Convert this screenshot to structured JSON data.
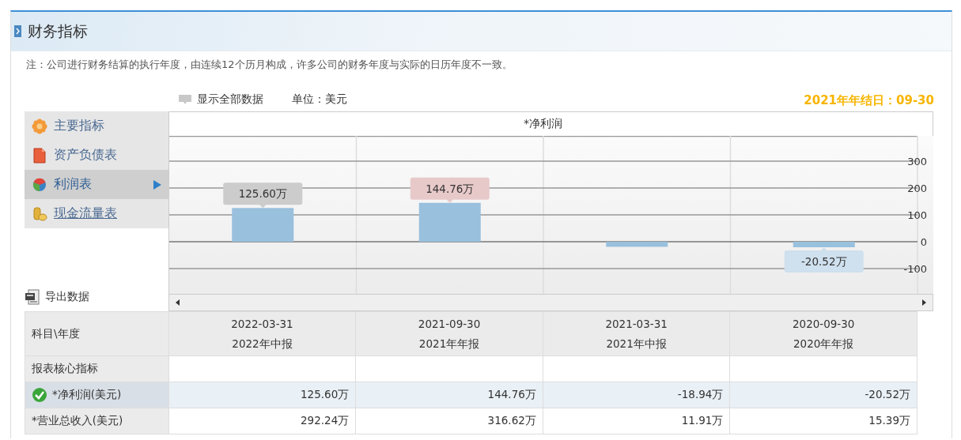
{
  "panel": {
    "title": "财务指标"
  },
  "note": "注：公司进行财务结算的执行年度，由连续12个历月构成，许多公司的财务年度与实际的日历年度不一致。",
  "toolbar": {
    "show_all": "显示全部数据",
    "unit": "单位：美元",
    "year_end": "2021年年结日：09-30"
  },
  "sidebar": {
    "items": [
      {
        "label": "主要指标",
        "kind": "flower",
        "selected": false,
        "underlined": false
      },
      {
        "label": "资产负债表",
        "kind": "document",
        "selected": false,
        "underlined": false
      },
      {
        "label": "利润表",
        "kind": "pie",
        "selected": true,
        "underlined": false
      },
      {
        "label": "现金流量表",
        "kind": "coins",
        "selected": false,
        "underlined": true
      }
    ]
  },
  "export": {
    "label": "导出数据"
  },
  "chart": {
    "value_tags": [
      {
        "color": "#cccccc"
      },
      {
        "color": "#e8c9c9"
      },
      {
        "color": "#cfe0ee"
      }
    ],
    "chart_data": {
      "type": "bar",
      "title": "*净利润",
      "values": [
        125.6,
        144.76,
        -18.94,
        -20.52
      ],
      "ylim": [
        -194,
        394
      ],
      "yticks": [
        -100,
        0,
        100,
        200,
        300
      ],
      "grid": true,
      "value_labels": [
        "125.60万",
        "144.76万",
        null,
        "-20.52万"
      ]
    }
  },
  "table": {
    "corner": "科目\\年度",
    "columns": [
      {
        "date": "2022-03-31",
        "report": "2022年中报"
      },
      {
        "date": "2021-09-30",
        "report": "2021年年报"
      },
      {
        "date": "2021-03-31",
        "report": "2021年中报"
      },
      {
        "date": "2020-09-30",
        "report": "2020年年报"
      }
    ],
    "rows": [
      {
        "kind": "section",
        "label": "报表核心指标"
      },
      {
        "kind": "data",
        "label": "*净利润(美元)",
        "selected": true,
        "checked": true,
        "cells": [
          "125.60万",
          "144.76万",
          "-18.94万",
          "-20.52万"
        ]
      },
      {
        "kind": "data",
        "label": "*营业总收入(美元)",
        "selected": false,
        "checked": false,
        "cells": [
          "292.24万",
          "316.62万",
          "11.91万",
          "15.39万"
        ]
      }
    ]
  }
}
